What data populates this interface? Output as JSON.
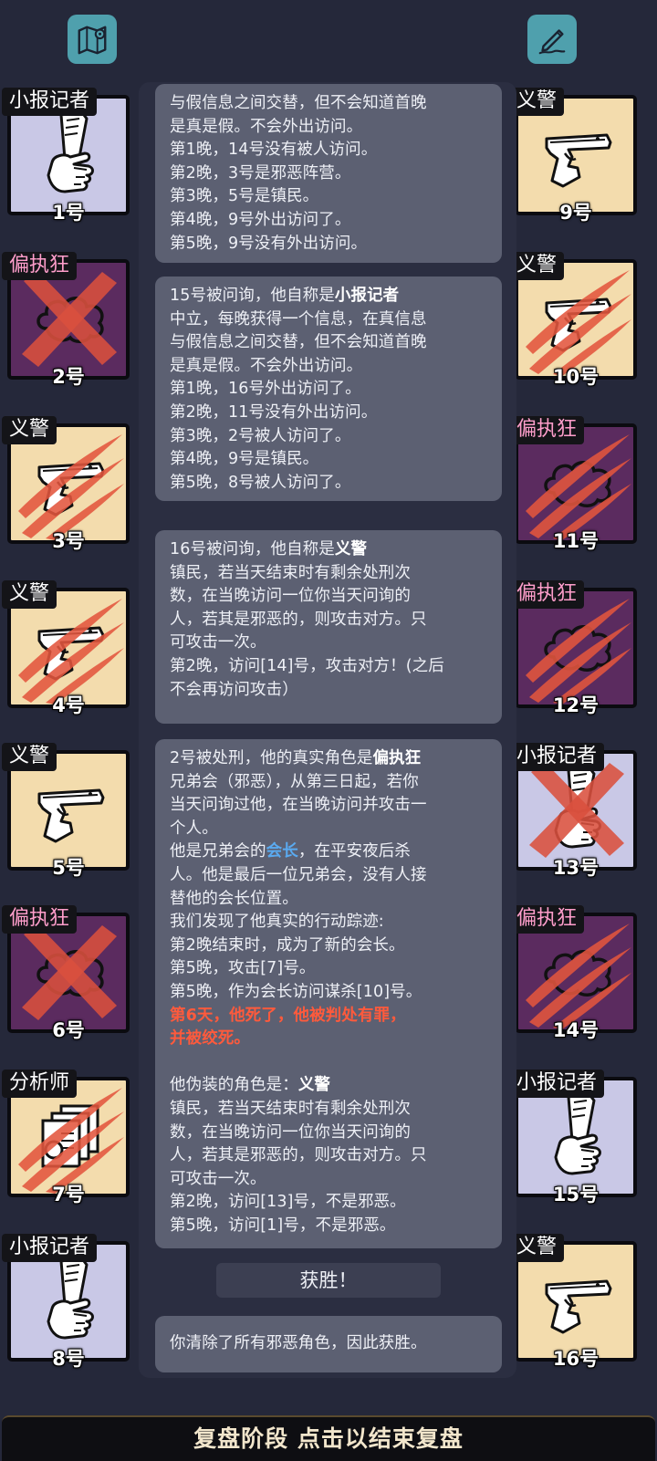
{
  "top_icons": {
    "left": "map-icon",
    "right": "notes-edit-icon"
  },
  "left_cards": [
    {
      "role": "小报记者",
      "number": "1号",
      "icon": "newspaper",
      "bg": "lavender",
      "state": "alive",
      "tag_color": "white"
    },
    {
      "role": "偏执狂",
      "number": "2号",
      "icon": "cloud",
      "bg": "purple",
      "state": "executed",
      "tag_color": "pink"
    },
    {
      "role": "义警",
      "number": "3号",
      "icon": "gun",
      "bg": "tan",
      "state": "clawed",
      "tag_color": "white"
    },
    {
      "role": "义警",
      "number": "4号",
      "icon": "gun",
      "bg": "tan",
      "state": "clawed",
      "tag_color": "white"
    },
    {
      "role": "义警",
      "number": "5号",
      "icon": "gun",
      "bg": "tan",
      "state": "alive",
      "tag_color": "white"
    },
    {
      "role": "偏执狂",
      "number": "6号",
      "icon": "cloud",
      "bg": "purple",
      "state": "executed",
      "tag_color": "pink"
    },
    {
      "role": "分析师",
      "number": "7号",
      "icon": "documents",
      "bg": "tan",
      "state": "clawed",
      "tag_color": "white"
    },
    {
      "role": "小报记者",
      "number": "8号",
      "icon": "newspaper",
      "bg": "lavender",
      "state": "alive",
      "tag_color": "white"
    }
  ],
  "right_cards": [
    {
      "role": "义警",
      "number": "9号",
      "icon": "gun",
      "bg": "tan",
      "state": "alive",
      "tag_color": "white"
    },
    {
      "role": "义警",
      "number": "10号",
      "icon": "gun",
      "bg": "tan",
      "state": "clawed",
      "tag_color": "white"
    },
    {
      "role": "偏执狂",
      "number": "11号",
      "icon": "cloud",
      "bg": "purple",
      "state": "clawed",
      "tag_color": "pink"
    },
    {
      "role": "偏执狂",
      "number": "12号",
      "icon": "cloud",
      "bg": "purple",
      "state": "clawed",
      "tag_color": "pink"
    },
    {
      "role": "小报记者",
      "number": "13号",
      "icon": "newspaper",
      "bg": "lavender",
      "state": "executed",
      "tag_color": "white"
    },
    {
      "role": "偏执狂",
      "number": "14号",
      "icon": "cloud",
      "bg": "purple",
      "state": "clawed",
      "tag_color": "pink"
    },
    {
      "role": "小报记者",
      "number": "15号",
      "icon": "newspaper",
      "bg": "lavender",
      "state": "alive",
      "tag_color": "white"
    },
    {
      "role": "义警",
      "number": "16号",
      "icon": "gun",
      "bg": "tan",
      "state": "alive",
      "tag_color": "white"
    }
  ],
  "messages": {
    "m1": {
      "lines": [
        "与假信息之间交替，但不会知道首晚",
        "是真是假。不会外出访问。",
        "第1晚，14号没有被人访问。",
        "第2晚，3号是邪恶阵营。",
        "第3晚，5号是镇民。",
        "第4晚，9号外出访问了。",
        "第5晚，9号没有外出访问。"
      ]
    },
    "m2": {
      "intro": "15号被问询，他自称是",
      "role": "小报记者",
      "lines": [
        "中立，每晚获得一个信息，在真信息",
        "与假信息之间交替，但不会知道首晚",
        "是真是假。不会外出访问。",
        "第1晚，16号外出访问了。",
        "第2晚，11号没有外出访问。",
        "第3晚，2号被人访问了。",
        "第4晚，9号是镇民。",
        "第5晚，8号被人访问了。"
      ]
    },
    "m3": {
      "intro": "16号被问询，他自称是",
      "role": "义警",
      "lines": [
        "镇民，若当天结束时有剩余处刑次",
        "数，在当晚访问一位你当天问询的",
        "人，若其是邪恶的，则攻击对方。只",
        "可攻击一次。",
        "第2晚，访问[14]号，攻击对方！(之后",
        "不会再访问攻击）"
      ]
    },
    "m4": {
      "intro": "2号被处刑，他的真实角色是",
      "role": "偏执狂",
      "lines_a": [
        "兄弟会（邪恶），从第三日起，若你",
        "当天问询过他，在当晚访问并攻击一",
        "个人。"
      ],
      "leader_prefix": "他是兄弟会的",
      "leader_word": "会长",
      "leader_suffix": "，在平安夜后杀",
      "lines_b": [
        "人。他是最后一位兄弟会，没有人接",
        "替他的会长位置。",
        "我们发现了他真实的行动踪迹:",
        "第2晚结束时，成为了新的会长。",
        "第5晚，攻击[7]号。",
        "第5晚，作为会长访问谋杀[10]号。"
      ],
      "death_lines": [
        "第6天，他死了，他被判处有罪，",
        "并被绞死。"
      ],
      "disguise_prefix": "他伪装的角色是：",
      "disguise_role": "义警",
      "lines_c": [
        "镇民，若当天结束时有剩余处刑次",
        "数，在当晚访问一位你当天问询的",
        "人，若其是邪恶的，则攻击对方。只",
        "可攻击一次。",
        "第2晚，访问[13]号，不是邪恶。",
        "第5晚，访问[1]号，不是邪恶。"
      ]
    },
    "victory_title": "获胜！",
    "victory_text": "你清除了所有邪恶角色，因此获胜。"
  },
  "bottom_bar": "复盘阶段 点击以结束复盘",
  "colors": {
    "background": "#25283a",
    "message_bg": "#5c6072",
    "accent_blue": "#5aaaf0",
    "accent_red": "#ff5a3c",
    "icon_teal": "#4fa0ad",
    "pink_tag": "#ff9ecb"
  }
}
